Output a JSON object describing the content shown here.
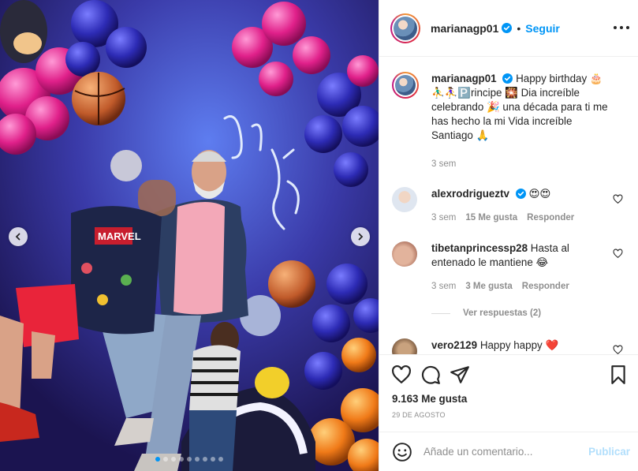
{
  "post": {
    "username": "marianagp01",
    "follow_label": "Seguir",
    "separator": "•",
    "caption": {
      "text": "Happy birthday 🎂⛹️‍♂️⛹️‍♀️🅿️rincipe 🎇 Dia increíble celebrando 🎉 una década para ti me has hecho la mi Vida increíble Santiago 🙏",
      "time": "3 sem"
    },
    "comments": [
      {
        "username": "alexrodrigueztv",
        "text": "😍😍",
        "time": "3 sem",
        "likes": "15 Me gusta",
        "reply_label": "Responder"
      },
      {
        "username": "tibetanprincessp28",
        "text": "Hasta al entenado le mantiene 😂",
        "time": "3 sem",
        "likes": "3 Me gusta",
        "reply_label": "Responder"
      },
      {
        "username": "vero2129",
        "text": "Happy happy ❤️"
      }
    ],
    "view_replies": "Ver respuestas (2)",
    "likes_count": "9.163 Me gusta",
    "date": "29 DE AGOSTO",
    "add_comment_placeholder": "Añade un comentario...",
    "publish_label": "Publicar",
    "carousel": {
      "slide_count": 9,
      "active_slide": 1
    }
  },
  "colors": {
    "accent": "#0095f6",
    "text": "#262626",
    "muted": "#8e8e8e",
    "heart_red": "#ed4956"
  },
  "icons": [
    "verified-badge-icon",
    "more-options-icon",
    "heart-icon",
    "comment-icon",
    "share-icon",
    "bookmark-icon",
    "emoji-icon",
    "chevron-left-icon",
    "chevron-right-icon"
  ]
}
